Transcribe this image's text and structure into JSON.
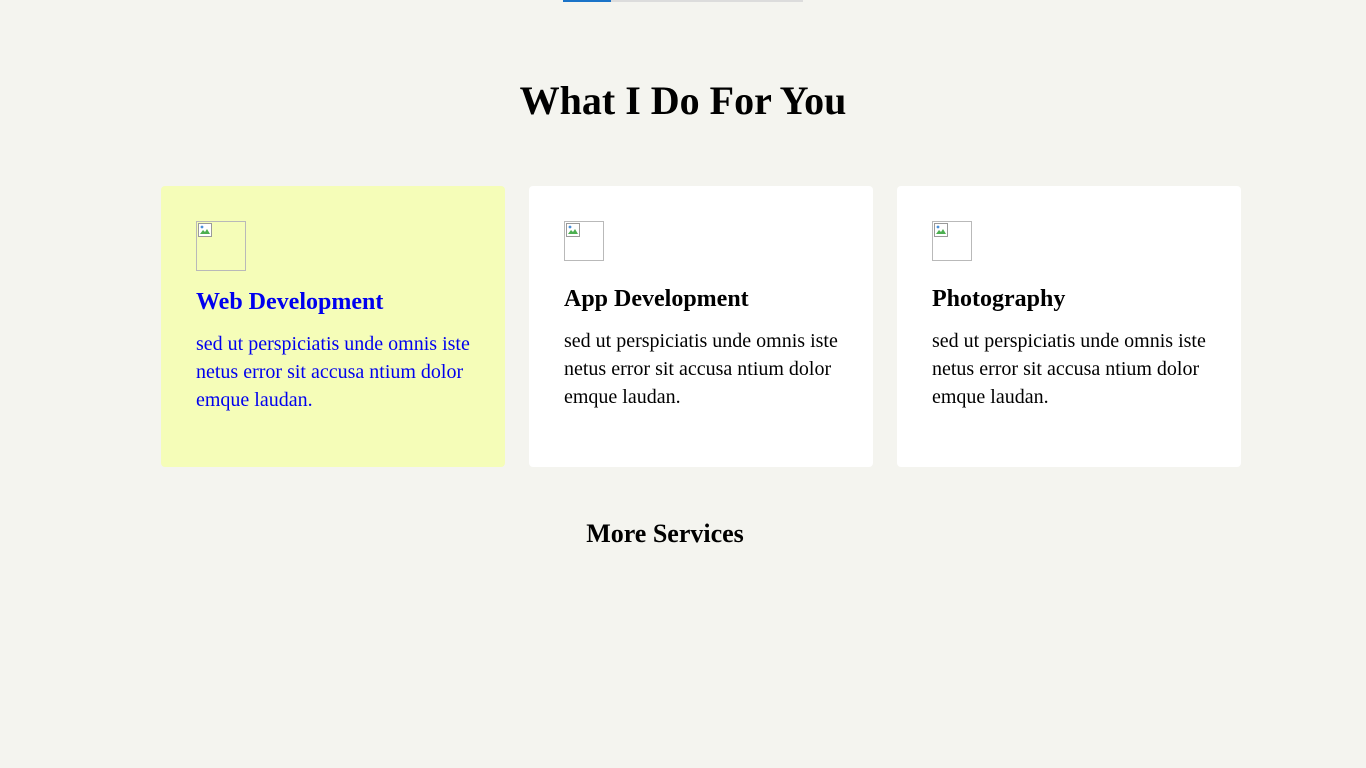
{
  "progress": {
    "value": 0.2,
    "color": "#1a73c8"
  },
  "section": {
    "title": "What I Do For You"
  },
  "services": [
    {
      "title": "Web Development",
      "description": "sed ut perspiciatis unde omnis iste netus error sit accusa ntium dolor emque laudan.",
      "icon": "broken-image-icon",
      "active": true
    },
    {
      "title": "App Development",
      "description": "sed ut perspiciatis unde omnis iste netus error sit accusa ntium dolor emque laudan.",
      "icon": "broken-image-icon",
      "active": false
    },
    {
      "title": "Photography",
      "description": "sed ut perspiciatis unde omnis iste netus error sit accusa ntium dolor emque laudan.",
      "icon": "broken-image-icon",
      "active": false
    }
  ],
  "more_services": {
    "label": "More Services"
  },
  "colors": {
    "background": "#f4f4ef",
    "active_card": "#f5fdb8",
    "active_text": "#0000ee",
    "card": "#ffffff"
  }
}
